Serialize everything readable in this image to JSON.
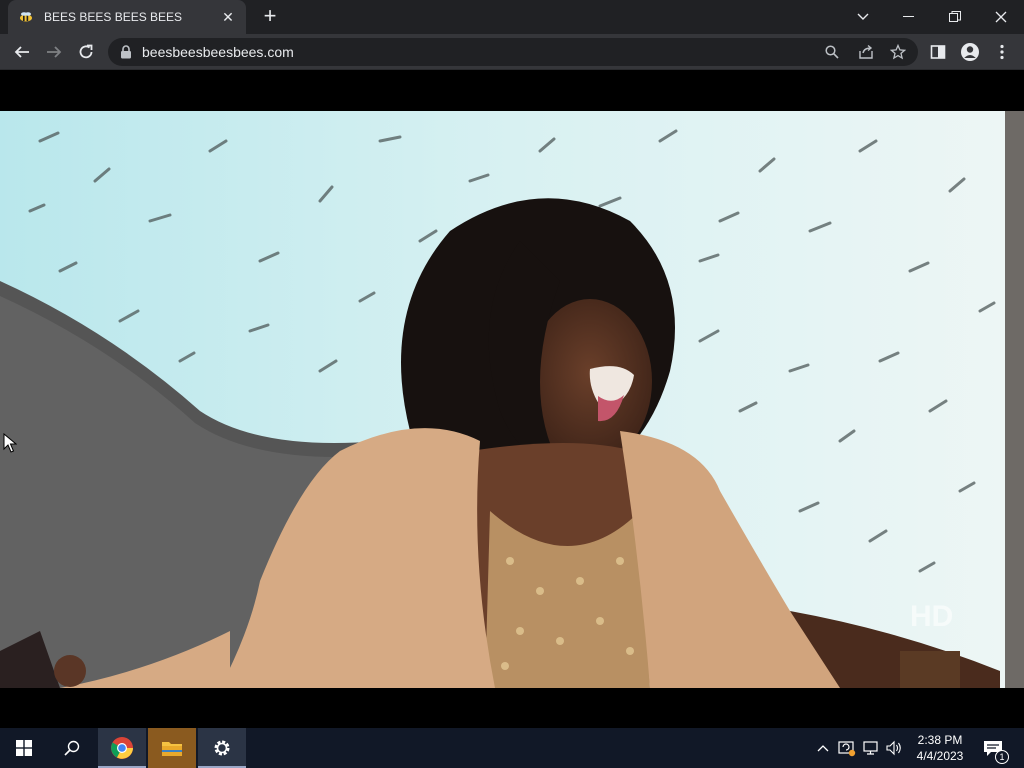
{
  "browser": {
    "tab_title": "BEES BEES BEES BEES",
    "url": "beesbeesbeesbees.com"
  },
  "icons": {
    "back": "arrow-left-icon",
    "forward": "arrow-right-icon",
    "reload": "reload-icon",
    "lock": "lock-icon",
    "search": "search-icon",
    "share": "share-icon",
    "bookmark": "star-icon",
    "sidepanel": "side-panel-icon",
    "profile": "profile-icon",
    "menu": "kebab-menu-icon"
  },
  "taskbar": {
    "time": "2:38 PM",
    "date": "4/4/2023",
    "notification_count": "1"
  },
  "colors": {
    "browser_frame": "#202124",
    "toolbar": "#35363a",
    "taskbar": "#111827",
    "sky": "#cfeef0",
    "jacket": "#d6aa84"
  }
}
